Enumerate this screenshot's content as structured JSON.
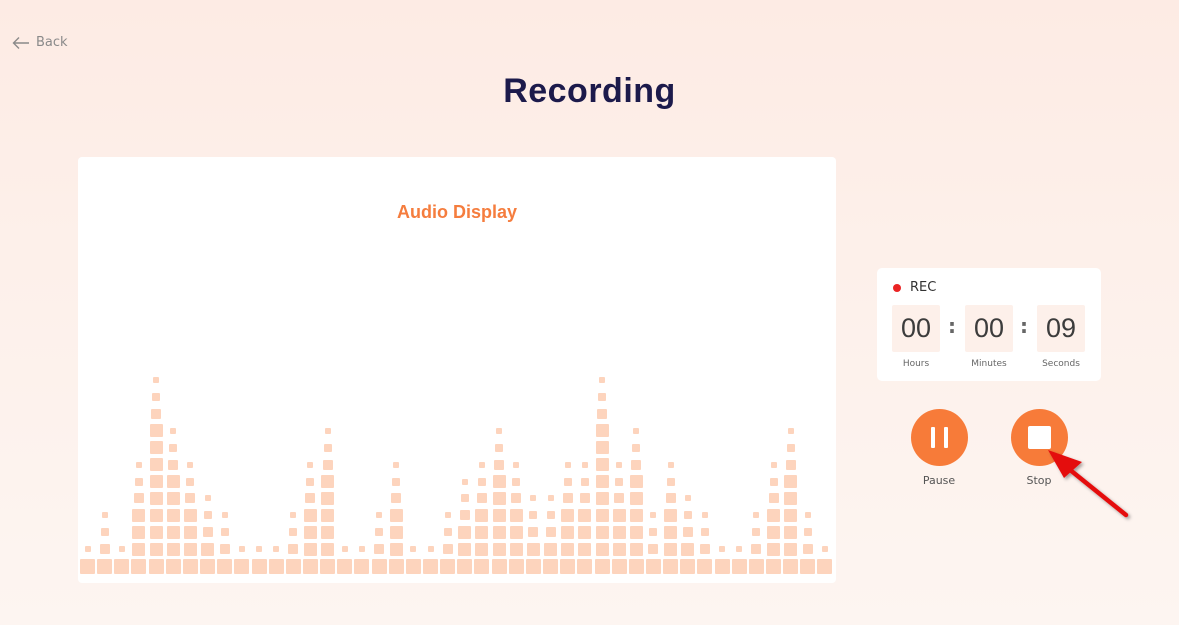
{
  "nav": {
    "back_label": "Back",
    "back_icon": "arrow-left-icon"
  },
  "page": {
    "title": "Recording"
  },
  "audio_display": {
    "title": "Audio Display",
    "accent_color": "#f57d3e",
    "bar_color": "#fdd4bd",
    "max_level": 12,
    "levels": [
      2,
      4,
      2,
      7,
      12,
      9,
      7,
      5,
      4,
      2,
      2,
      2,
      4,
      7,
      9,
      2,
      2,
      4,
      7,
      2,
      2,
      4,
      6,
      7,
      9,
      7,
      5,
      5,
      7,
      7,
      12,
      7,
      9,
      4,
      7,
      5,
      4,
      2,
      2,
      4,
      7,
      9,
      4,
      2
    ]
  },
  "timer": {
    "status": "REC",
    "status_color": "#ea2424",
    "hours": "00",
    "minutes": "00",
    "seconds": "09",
    "separator": ":",
    "hours_label": "Hours",
    "minutes_label": "Minutes",
    "seconds_label": "Seconds"
  },
  "controls": {
    "pause_label": "Pause",
    "stop_label": "Stop",
    "button_color": "#f77b39"
  }
}
